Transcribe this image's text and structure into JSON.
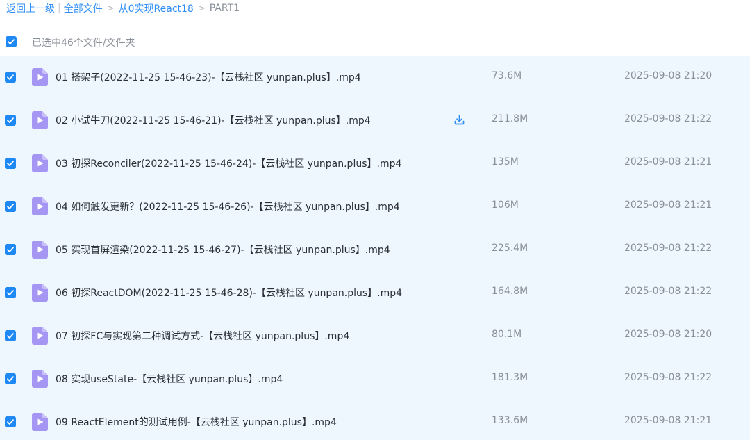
{
  "breadcrumb": {
    "back": "返回上一级",
    "all_files": "全部文件",
    "parent": "从0实现React18",
    "current": "PART1",
    "separator": ">"
  },
  "selection": {
    "summary": "已选中46个文件/文件夹",
    "all_checked": true
  },
  "colors": {
    "accent": "#1e88f5",
    "row_selected_bg": "#eef6fe",
    "video_icon": "#9b8cf0"
  },
  "files": [
    {
      "name": "01 搭架子(2022-11-25 15-46-23)-【云栈社区 yunpan.plus】.mp4",
      "size": "73.6M",
      "modified": "2025-09-08 21:20",
      "checked": true,
      "icon": "video-file-icon"
    },
    {
      "name": "02 小试牛刀(2022-11-25 15-46-21)-【云栈社区 yunpan.plus】.mp4",
      "size": "211.8M",
      "modified": "2025-09-08 21:22",
      "checked": true,
      "icon": "video-file-icon",
      "hover": true
    },
    {
      "name": "03 初探Reconciler(2022-11-25 15-46-24)-【云栈社区 yunpan.plus】.mp4",
      "size": "135M",
      "modified": "2025-09-08 21:21",
      "checked": true,
      "icon": "video-file-icon"
    },
    {
      "name": "04 如何触发更新？(2022-11-25 15-46-26)-【云栈社区 yunpan.plus】.mp4",
      "size": "106M",
      "modified": "2025-09-08 21:21",
      "checked": true,
      "icon": "video-file-icon"
    },
    {
      "name": "05 实现首屏渲染(2022-11-25 15-46-27)-【云栈社区 yunpan.plus】.mp4",
      "size": "225.4M",
      "modified": "2025-09-08 21:22",
      "checked": true,
      "icon": "video-file-icon"
    },
    {
      "name": "06 初探ReactDOM(2022-11-25 15-46-28)-【云栈社区 yunpan.plus】.mp4",
      "size": "164.8M",
      "modified": "2025-09-08 21:22",
      "checked": true,
      "icon": "video-file-icon"
    },
    {
      "name": "07 初探FC与实现第二种调试方式-【云栈社区 yunpan.plus】.mp4",
      "size": "80.1M",
      "modified": "2025-09-08 21:20",
      "checked": true,
      "icon": "video-file-icon"
    },
    {
      "name": "08 实现useState-【云栈社区 yunpan.plus】.mp4",
      "size": "181.3M",
      "modified": "2025-09-08 21:22",
      "checked": true,
      "icon": "video-file-icon"
    },
    {
      "name": "09 ReactElement的测试用例-【云栈社区 yunpan.plus】.mp4",
      "size": "133.6M",
      "modified": "2025-09-08 21:21",
      "checked": true,
      "icon": "video-file-icon"
    }
  ]
}
